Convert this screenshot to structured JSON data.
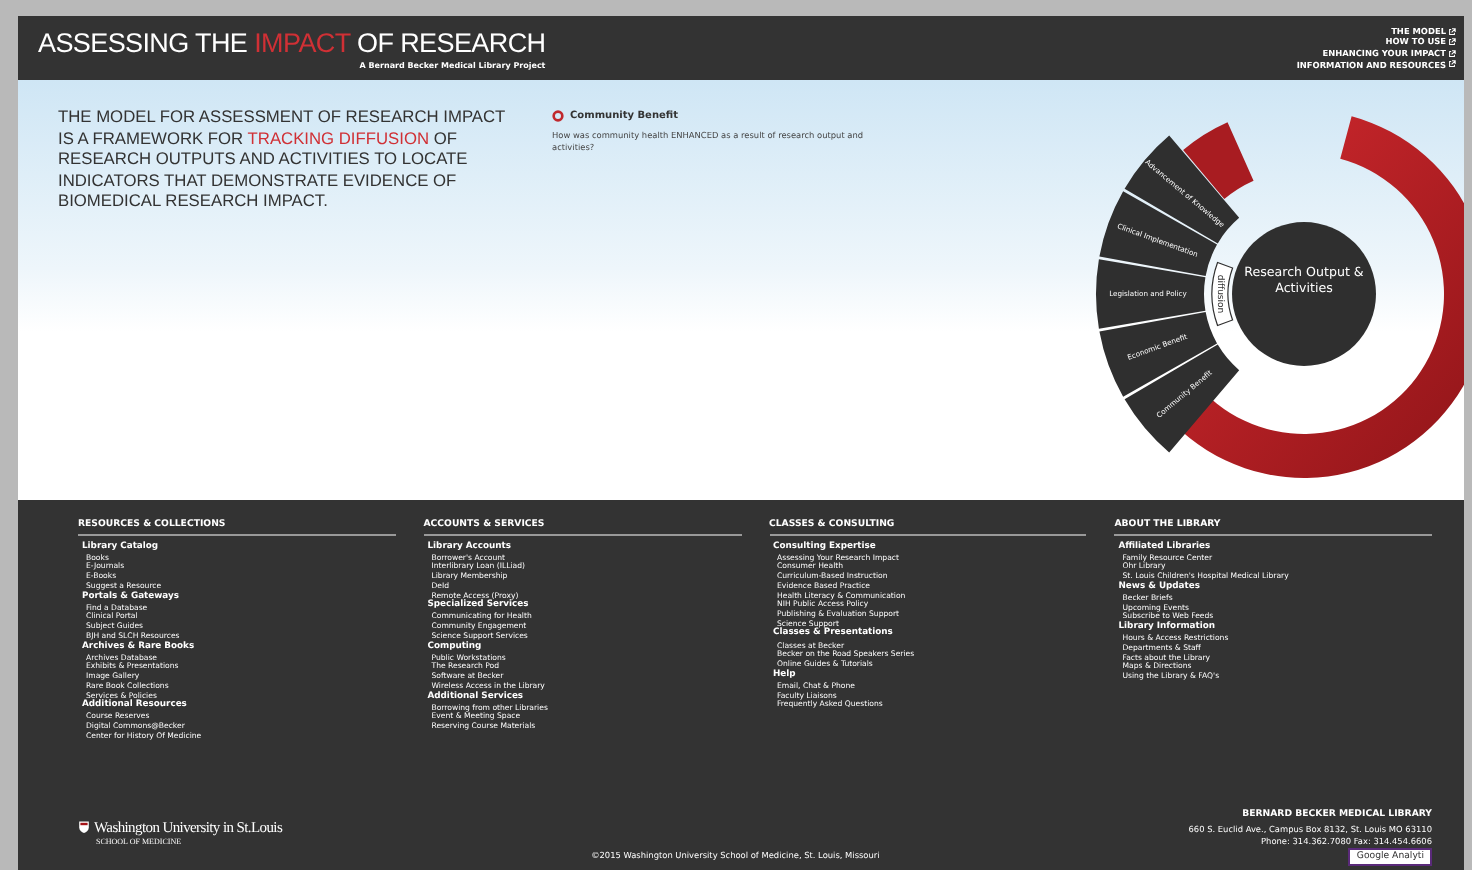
{
  "header": {
    "title": {
      "before": "ASSESSING THE ",
      "highlight": "IMPACT",
      "after": " OF RESEARCH"
    },
    "subtitle": "A Bernard Becker Medical Library Project",
    "nav": [
      "THE MODEL",
      "HOW TO USE",
      "ENHANCING YOUR IMPACT",
      "INFORMATION AND RESOURCES"
    ]
  },
  "hero": {
    "statement": {
      "before": "THE MODEL FOR ASSESSMENT OF RESEARCH IMPACT IS A FRAMEWORK FOR ",
      "highlight": "TRACKING DIFFUSION",
      "after": " OF RESEARCH OUTPUTS AND ACTIVITIES TO LOCATE INDICATORS THAT DEMONSTRATE EVIDENCE OF BIOMEDICAL RESEARCH IMPACT."
    },
    "topic": {
      "title": "Community Benefit",
      "question": "How was community health ENHANCED as a result of research output and activities?"
    },
    "diagram": {
      "center": "Research Output & Activities",
      "ring_label": "diffusion",
      "segments": [
        "Advancement of Knowledge",
        "Clinical Implementation",
        "Legislation and Policy",
        "Economic Benefit",
        "Community Benefit"
      ]
    }
  },
  "footer": {
    "columns": [
      {
        "heading": "RESOURCES & COLLECTIONS",
        "groups": [
          {
            "title": "Library Catalog",
            "links": [
              "Books",
              "E-Journals",
              "E-Books",
              "Suggest a Resource"
            ]
          },
          {
            "title": "Portals & Gateways",
            "links": [
              "Find a Database",
              "Clinical Portal",
              "Subject Guides",
              "BJH and SLCH Resources"
            ]
          },
          {
            "title": "Archives & Rare Books",
            "links": [
              "Archives Database",
              "Exhibits & Presentations",
              "Image Gallery",
              "Rare Book Collections",
              "Services & Policies"
            ]
          },
          {
            "title": "Additional Resources",
            "links": [
              "Course Reserves",
              "Digital Commons@Becker",
              "Center for History Of Medicine"
            ]
          }
        ]
      },
      {
        "heading": "ACCOUNTS & SERVICES",
        "groups": [
          {
            "title": "Library Accounts",
            "links": [
              "Borrower's Account",
              "Interlibrary Loan (ILLiad)",
              "Library Membership",
              "DeId",
              "Remote Access (Proxy)"
            ]
          },
          {
            "title": "Specialized Services",
            "links": [
              "Communicating for Health",
              "Community Engagement",
              "Science Support Services"
            ]
          },
          {
            "title": "Computing",
            "links": [
              "Public Workstations",
              "The Research Pod",
              "Software at Becker",
              "Wireless Access in the Library"
            ]
          },
          {
            "title": "Additional Services",
            "links": [
              "Borrowing from other Libraries",
              "Event & Meeting Space",
              "Reserving Course Materials"
            ]
          }
        ]
      },
      {
        "heading": "CLASSES & CONSULTING",
        "groups": [
          {
            "title": "Consulting Expertise",
            "links": [
              "Assessing Your Research Impact",
              "Consumer Health",
              "Curriculum-Based Instruction",
              "Evidence Based Practice",
              "Health Literacy & Communication",
              "NIH Public Access Policy",
              "Publishing & Evaluation Support",
              "Science Support"
            ]
          },
          {
            "title": "Classes & Presentations",
            "links": [
              "Classes at Becker",
              "Becker on the Road Speakers Series",
              "Online Guides & Tutorials"
            ]
          },
          {
            "title": "Help",
            "links": [
              "Email, Chat & Phone",
              "Faculty Liaisons",
              "Frequently Asked Questions"
            ]
          }
        ]
      },
      {
        "heading": "ABOUT THE LIBRARY",
        "groups": [
          {
            "title": "Affiliated Libraries",
            "links": [
              "Family Resource Center",
              "Ohr Library",
              "St. Louis Children's Hospital Medical Library"
            ]
          },
          {
            "title": "News & Updates",
            "links": [
              "Becker Briefs",
              "Upcoming Events",
              "Subscribe to Web Feeds"
            ]
          },
          {
            "title": "Library Information",
            "links": [
              "Hours & Access Restrictions",
              "Departments & Staff",
              "Facts about the Library",
              "Maps & Directions",
              "Using the Library & FAQ's"
            ]
          }
        ]
      }
    ],
    "logo": {
      "name": "Washington University in St.Louis",
      "school": "SCHOOL OF MEDICINE"
    },
    "copyright": "©2015 Washington University School of Medicine, St. Louis, Missouri",
    "library": {
      "name": "BERNARD BECKER MEDICAL LIBRARY",
      "address": "660 S. Euclid Ave., Campus Box 8132, St. Louis MO 63110",
      "phone": "Phone: 314.362.7080 Fax: 314.454.6606"
    },
    "badge": "Google Analyti"
  }
}
